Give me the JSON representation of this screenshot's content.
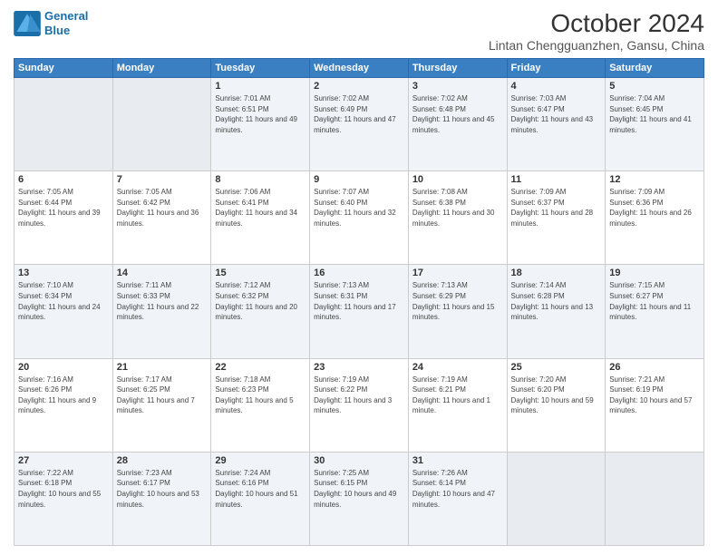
{
  "header": {
    "logo_line1": "General",
    "logo_line2": "Blue",
    "month": "October 2024",
    "location": "Lintan Chengguanzhen, Gansu, China"
  },
  "days_of_week": [
    "Sunday",
    "Monday",
    "Tuesday",
    "Wednesday",
    "Thursday",
    "Friday",
    "Saturday"
  ],
  "weeks": [
    [
      {
        "day": "",
        "detail": ""
      },
      {
        "day": "",
        "detail": ""
      },
      {
        "day": "1",
        "detail": "Sunrise: 7:01 AM\nSunset: 6:51 PM\nDaylight: 11 hours and 49 minutes."
      },
      {
        "day": "2",
        "detail": "Sunrise: 7:02 AM\nSunset: 6:49 PM\nDaylight: 11 hours and 47 minutes."
      },
      {
        "day": "3",
        "detail": "Sunrise: 7:02 AM\nSunset: 6:48 PM\nDaylight: 11 hours and 45 minutes."
      },
      {
        "day": "4",
        "detail": "Sunrise: 7:03 AM\nSunset: 6:47 PM\nDaylight: 11 hours and 43 minutes."
      },
      {
        "day": "5",
        "detail": "Sunrise: 7:04 AM\nSunset: 6:45 PM\nDaylight: 11 hours and 41 minutes."
      }
    ],
    [
      {
        "day": "6",
        "detail": "Sunrise: 7:05 AM\nSunset: 6:44 PM\nDaylight: 11 hours and 39 minutes."
      },
      {
        "day": "7",
        "detail": "Sunrise: 7:05 AM\nSunset: 6:42 PM\nDaylight: 11 hours and 36 minutes."
      },
      {
        "day": "8",
        "detail": "Sunrise: 7:06 AM\nSunset: 6:41 PM\nDaylight: 11 hours and 34 minutes."
      },
      {
        "day": "9",
        "detail": "Sunrise: 7:07 AM\nSunset: 6:40 PM\nDaylight: 11 hours and 32 minutes."
      },
      {
        "day": "10",
        "detail": "Sunrise: 7:08 AM\nSunset: 6:38 PM\nDaylight: 11 hours and 30 minutes."
      },
      {
        "day": "11",
        "detail": "Sunrise: 7:09 AM\nSunset: 6:37 PM\nDaylight: 11 hours and 28 minutes."
      },
      {
        "day": "12",
        "detail": "Sunrise: 7:09 AM\nSunset: 6:36 PM\nDaylight: 11 hours and 26 minutes."
      }
    ],
    [
      {
        "day": "13",
        "detail": "Sunrise: 7:10 AM\nSunset: 6:34 PM\nDaylight: 11 hours and 24 minutes."
      },
      {
        "day": "14",
        "detail": "Sunrise: 7:11 AM\nSunset: 6:33 PM\nDaylight: 11 hours and 22 minutes."
      },
      {
        "day": "15",
        "detail": "Sunrise: 7:12 AM\nSunset: 6:32 PM\nDaylight: 11 hours and 20 minutes."
      },
      {
        "day": "16",
        "detail": "Sunrise: 7:13 AM\nSunset: 6:31 PM\nDaylight: 11 hours and 17 minutes."
      },
      {
        "day": "17",
        "detail": "Sunrise: 7:13 AM\nSunset: 6:29 PM\nDaylight: 11 hours and 15 minutes."
      },
      {
        "day": "18",
        "detail": "Sunrise: 7:14 AM\nSunset: 6:28 PM\nDaylight: 11 hours and 13 minutes."
      },
      {
        "day": "19",
        "detail": "Sunrise: 7:15 AM\nSunset: 6:27 PM\nDaylight: 11 hours and 11 minutes."
      }
    ],
    [
      {
        "day": "20",
        "detail": "Sunrise: 7:16 AM\nSunset: 6:26 PM\nDaylight: 11 hours and 9 minutes."
      },
      {
        "day": "21",
        "detail": "Sunrise: 7:17 AM\nSunset: 6:25 PM\nDaylight: 11 hours and 7 minutes."
      },
      {
        "day": "22",
        "detail": "Sunrise: 7:18 AM\nSunset: 6:23 PM\nDaylight: 11 hours and 5 minutes."
      },
      {
        "day": "23",
        "detail": "Sunrise: 7:19 AM\nSunset: 6:22 PM\nDaylight: 11 hours and 3 minutes."
      },
      {
        "day": "24",
        "detail": "Sunrise: 7:19 AM\nSunset: 6:21 PM\nDaylight: 11 hours and 1 minute."
      },
      {
        "day": "25",
        "detail": "Sunrise: 7:20 AM\nSunset: 6:20 PM\nDaylight: 10 hours and 59 minutes."
      },
      {
        "day": "26",
        "detail": "Sunrise: 7:21 AM\nSunset: 6:19 PM\nDaylight: 10 hours and 57 minutes."
      }
    ],
    [
      {
        "day": "27",
        "detail": "Sunrise: 7:22 AM\nSunset: 6:18 PM\nDaylight: 10 hours and 55 minutes."
      },
      {
        "day": "28",
        "detail": "Sunrise: 7:23 AM\nSunset: 6:17 PM\nDaylight: 10 hours and 53 minutes."
      },
      {
        "day": "29",
        "detail": "Sunrise: 7:24 AM\nSunset: 6:16 PM\nDaylight: 10 hours and 51 minutes."
      },
      {
        "day": "30",
        "detail": "Sunrise: 7:25 AM\nSunset: 6:15 PM\nDaylight: 10 hours and 49 minutes."
      },
      {
        "day": "31",
        "detail": "Sunrise: 7:26 AM\nSunset: 6:14 PM\nDaylight: 10 hours and 47 minutes."
      },
      {
        "day": "",
        "detail": ""
      },
      {
        "day": "",
        "detail": ""
      }
    ]
  ]
}
